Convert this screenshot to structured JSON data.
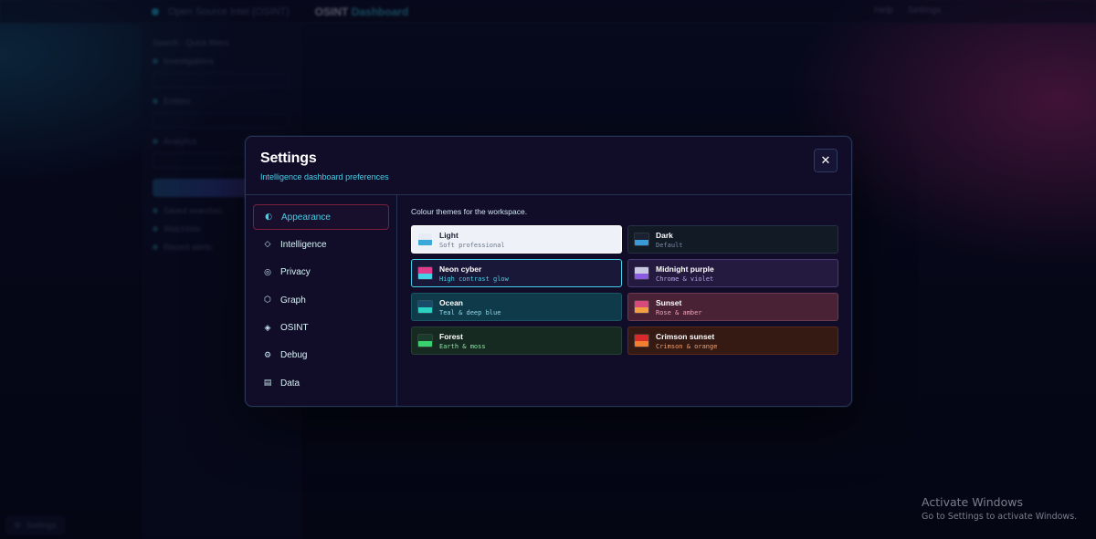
{
  "background": {
    "brand": "Open Source Intel (OSINT)",
    "title_accent": "OSINT",
    "title_rest": "Dashboard",
    "top_right": [
      "Help",
      "Settings"
    ],
    "sidebar": {
      "section": "Search · Quick filters",
      "groups": [
        "Investigations",
        "Entities",
        "Analytics"
      ],
      "links": [
        "Saved searches",
        "Watchlists",
        "Recent alerts"
      ]
    },
    "settings_button": "Settings"
  },
  "modal": {
    "title": "Settings",
    "subtitle": "Intelligence dashboard preferences",
    "close_label": "✕",
    "nav": [
      {
        "label": "Appearance",
        "icon": "contrast-icon",
        "glyph": "◐",
        "active": true
      },
      {
        "label": "Intelligence",
        "icon": "diamond-icon",
        "glyph": "◇",
        "active": false
      },
      {
        "label": "Privacy",
        "icon": "shield-icon",
        "glyph": "◎",
        "active": false
      },
      {
        "label": "Graph",
        "icon": "hexagon-icon",
        "glyph": "⬡",
        "active": false
      },
      {
        "label": "OSINT",
        "icon": "target-icon",
        "glyph": "◈",
        "active": false
      },
      {
        "label": "Debug",
        "icon": "gear-icon",
        "glyph": "⚙",
        "active": false
      },
      {
        "label": "Data",
        "icon": "database-icon",
        "glyph": "▤",
        "active": false
      }
    ],
    "content": {
      "description": "Colour themes for the workspace.",
      "themes": [
        {
          "name": "Light",
          "desc": "Soft professional",
          "swatch": [
            "#e6ecf6",
            "#3aa8d8"
          ],
          "selected": false
        },
        {
          "name": "Dark",
          "desc": "Default",
          "swatch": [
            "#1a2232",
            "#3a9ad8"
          ],
          "selected": false
        },
        {
          "name": "Neon cyber",
          "desc": "High contrast glow",
          "swatch": [
            "#e03a8a",
            "#46d0e8"
          ],
          "selected": true
        },
        {
          "name": "Midnight purple",
          "desc": "Chrome & violet",
          "swatch": [
            "#c8c8e0",
            "#8a5ae0"
          ],
          "selected": false
        },
        {
          "name": "Ocean",
          "desc": "Teal & deep blue",
          "swatch": [
            "#1a4a6a",
            "#2ad0c0"
          ],
          "selected": false
        },
        {
          "name": "Sunset",
          "desc": "Rose & amber",
          "swatch": [
            "#d84a7a",
            "#f0a040"
          ],
          "selected": false
        },
        {
          "name": "Forest",
          "desc": "Earth & moss",
          "swatch": [
            "#1a3a2a",
            "#3ad070"
          ],
          "selected": false
        },
        {
          "name": "Crimson sunset",
          "desc": "Crimson & orange",
          "swatch": [
            "#d82a2a",
            "#f08030"
          ],
          "selected": false
        }
      ]
    }
  },
  "watermark": {
    "line1": "Activate Windows",
    "line2": "Go to Settings to activate Windows."
  }
}
